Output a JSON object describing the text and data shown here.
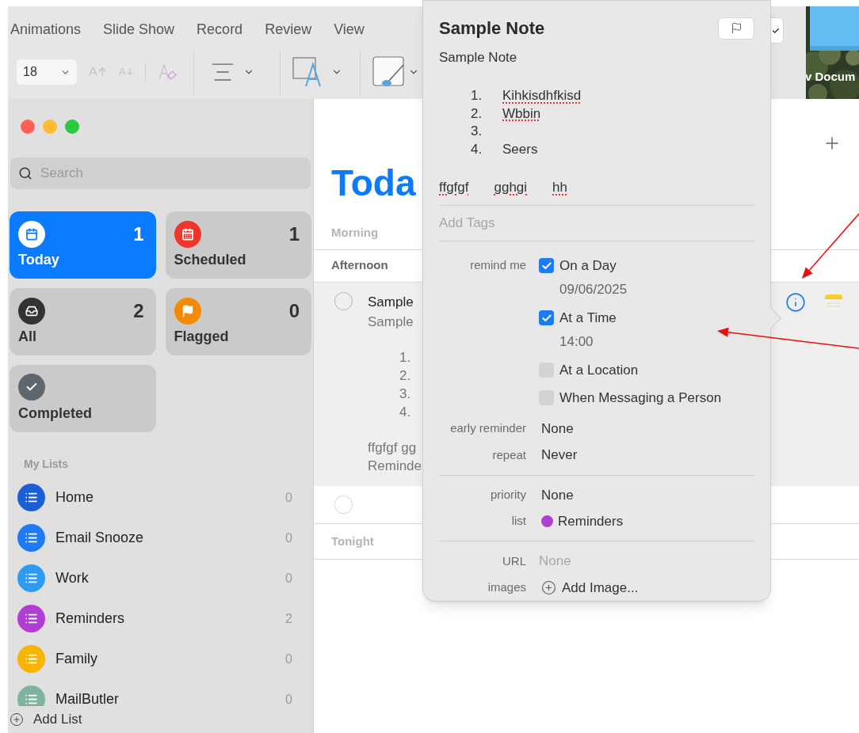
{
  "ribbon": {
    "tabs": [
      {
        "label": "Animations"
      },
      {
        "label": "Slide Show"
      },
      {
        "label": "Record"
      },
      {
        "label": "Review"
      },
      {
        "label": "View"
      }
    ],
    "font_size": "18"
  },
  "desktop": {
    "icon_label": "v Docum"
  },
  "sidebar": {
    "search": {
      "placeholder": "Search"
    },
    "smart_lists": [
      {
        "kind": "today",
        "label": "Today",
        "count": "1",
        "color": "#ffffff",
        "selected": true
      },
      {
        "kind": "scheduled",
        "label": "Scheduled",
        "count": "1",
        "color": "#f0352b",
        "selected": false
      },
      {
        "kind": "all",
        "label": "All",
        "count": "2",
        "color": "#333333",
        "selected": false
      },
      {
        "kind": "flagged",
        "label": "Flagged",
        "count": "0",
        "color": "#f58a07",
        "selected": false
      },
      {
        "kind": "completed",
        "label": "Completed",
        "color": "#5c6770",
        "selected": false
      }
    ],
    "my_lists_heading": "My Lists",
    "lists": [
      {
        "name": "Home",
        "count": "0",
        "color": "#1a5fd6"
      },
      {
        "name": "Email Snooze",
        "count": "0",
        "color": "#1f7bf2"
      },
      {
        "name": "Work",
        "count": "0",
        "color": "#2f9bf0"
      },
      {
        "name": "Reminders",
        "count": "2",
        "color": "#b03ed4"
      },
      {
        "name": "Family",
        "count": "0",
        "color": "#f7b500"
      },
      {
        "name": "MailButler",
        "count": "0",
        "color": "#7fb39c"
      }
    ],
    "add_list": "Add List"
  },
  "main": {
    "title": "Toda",
    "sections": [
      {
        "label": "Morning",
        "active": false
      },
      {
        "label": "Afternoon",
        "active": true
      }
    ],
    "reminder": {
      "title": "Sample",
      "notes": "Sample",
      "numbers": [
        "1.",
        "2.",
        "3.",
        "4."
      ],
      "text_line": "ffgfgf gg",
      "list_line": "Reminde",
      "selected": true
    },
    "after_sections": [
      {
        "label": "Tonight",
        "active": false
      }
    ]
  },
  "popover": {
    "title": "Sample Note",
    "notes": "Sample Note",
    "items": [
      {
        "number": "1.",
        "text": "Kihkisdhfkisd",
        "misspelled": true
      },
      {
        "number": "2.",
        "text": "Wbbin",
        "misspelled": true
      },
      {
        "number": "3."
      },
      {
        "number": "4.",
        "text": "Seers",
        "misspelled": false
      }
    ],
    "words": [
      {
        "text": "ffgfgf",
        "misspelled": true
      },
      {
        "text": "gghgi",
        "misspelled": true
      },
      {
        "text": "hh",
        "misspelled": true
      }
    ],
    "tags_placeholder": "Add Tags",
    "remind_label": "remind me",
    "remind_options": [
      {
        "label": "On a Day",
        "checked": true,
        "value": "09/06/2025"
      },
      {
        "label": "At a Time",
        "checked": true,
        "value": "14:00"
      },
      {
        "label": "At a Location",
        "checked": false
      },
      {
        "label": "When Messaging a Person",
        "checked": false
      }
    ],
    "early_reminder": {
      "label": "early reminder",
      "value": "None"
    },
    "repeat": {
      "label": "repeat",
      "value": "Never"
    },
    "priority": {
      "label": "priority",
      "value": "None"
    },
    "list": {
      "label": "list",
      "value": "Reminders",
      "color": "#b03ed4"
    },
    "url": {
      "label": "URL",
      "placeholder": "None"
    },
    "images": {
      "label": "images",
      "action": "Add Image..."
    }
  }
}
